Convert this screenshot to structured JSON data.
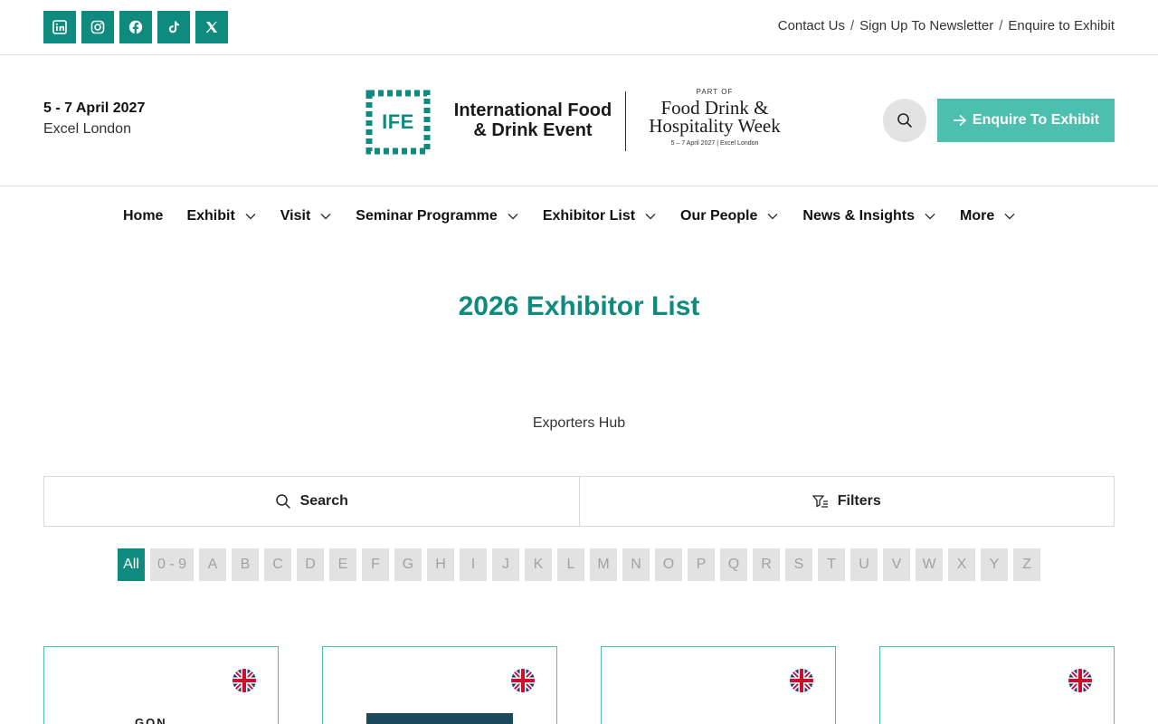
{
  "topbar": {
    "socials": [
      {
        "icon": "linkedin-icon"
      },
      {
        "icon": "instagram-icon"
      },
      {
        "icon": "facebook-icon"
      },
      {
        "icon": "tiktok-icon"
      },
      {
        "icon": "x-icon"
      }
    ],
    "links": [
      "Contact Us",
      "Sign Up To Newsletter",
      "Enquire to Exhibit"
    ],
    "separator": "/"
  },
  "header": {
    "date": "5 - 7 April 2027",
    "venue": "Excel London",
    "logo": {
      "mark": "IFE",
      "name_line1": "International Food",
      "name_line2": "& Drink Event",
      "part_of": "PART OF",
      "week_line1": "Food Drink &",
      "week_line2": "Hospitality Week",
      "week_small": "5 – 7 April 2027 | Excel London"
    },
    "search_icon": "search-icon",
    "enquire_label": "Enquire To Exhibit"
  },
  "nav": {
    "items": [
      {
        "label": "Home",
        "dropdown": false
      },
      {
        "label": "Exhibit",
        "dropdown": true
      },
      {
        "label": "Visit",
        "dropdown": true
      },
      {
        "label": "Seminar Programme",
        "dropdown": true
      },
      {
        "label": "Exhibitor List",
        "dropdown": true
      },
      {
        "label": "Our People",
        "dropdown": true
      },
      {
        "label": "News & Insights",
        "dropdown": true
      },
      {
        "label": "More",
        "dropdown": true
      }
    ]
  },
  "main": {
    "title": "2026 Exhibitor List",
    "hub_link": "Exporters Hub",
    "search_label": "Search",
    "filters_label": "Filters",
    "alphabet": [
      "All",
      "0 - 9",
      "A",
      "B",
      "C",
      "D",
      "E",
      "F",
      "G",
      "H",
      "I",
      "J",
      "K",
      "L",
      "M",
      "N",
      "O",
      "P",
      "Q",
      "R",
      "S",
      "T",
      "U",
      "V",
      "W",
      "X",
      "Y",
      "Z"
    ],
    "active_letter": "All",
    "cards": [
      {
        "flag": "uk-flag-icon",
        "logo_text": "GON"
      },
      {
        "flag": "uk-flag-icon",
        "logo_text": ""
      },
      {
        "flag": "uk-flag-icon",
        "logo_text": ""
      },
      {
        "flag": "uk-flag-icon",
        "logo_text": ""
      }
    ]
  },
  "colors": {
    "brand": "#0f8a7e",
    "accent": "#4cbfae",
    "letter_bg": "#e2e2e2"
  }
}
